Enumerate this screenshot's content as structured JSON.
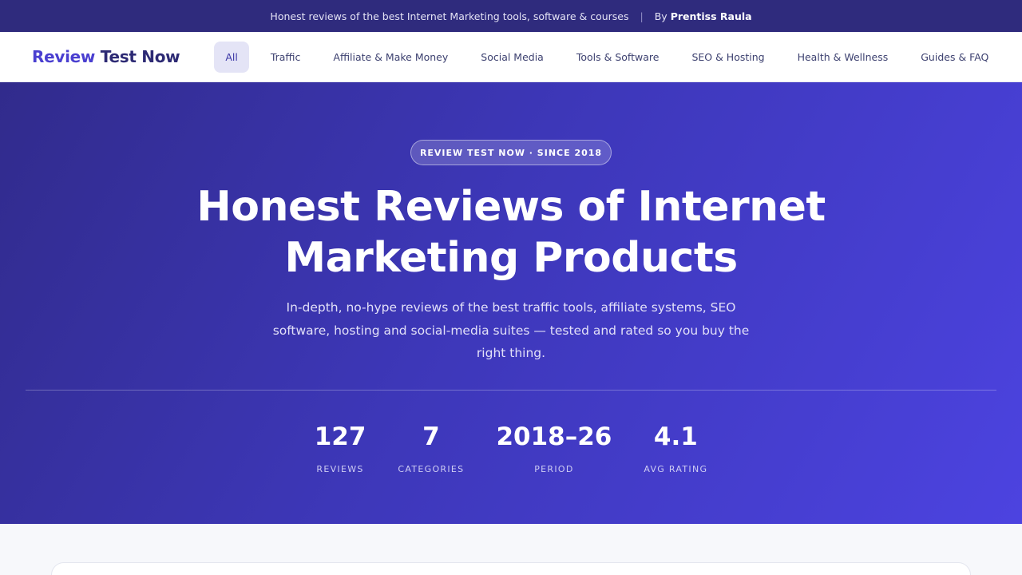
{
  "topbar": {
    "tagline": "Honest reviews of the best Internet Marketing tools, software & courses",
    "separator": "|",
    "by_label": "By",
    "author": "Prentiss Raula"
  },
  "logo": {
    "part1": "Review",
    "part2": "Test Now"
  },
  "nav": {
    "items": [
      {
        "label": "All",
        "active": true
      },
      {
        "label": "Traffic"
      },
      {
        "label": "Affiliate & Make Money"
      },
      {
        "label": "Social Media"
      },
      {
        "label": "Tools & Software"
      },
      {
        "label": "SEO & Hosting"
      },
      {
        "label": "Health & Wellness"
      },
      {
        "label": "Guides & FAQ"
      }
    ]
  },
  "hero": {
    "badge": "REVIEW TEST NOW · SINCE 2018",
    "title": "Honest Reviews of Internet Marketing Products",
    "subtitle": "In-depth, no-hype reviews of the best traffic tools, affiliate systems, SEO software, hosting and social-media suites — tested and rated so you buy the right thing.",
    "stats": [
      {
        "value": "127",
        "label": "REVIEWS"
      },
      {
        "value": "7",
        "label": "CATEGORIES"
      },
      {
        "value": "2018–26",
        "label": "PERIOD"
      },
      {
        "value": "4.1",
        "label": "AVG RATING"
      }
    ]
  },
  "colors": {
    "topbar_bg": "#2f2b7d",
    "accent": "#4a3fd0",
    "hero_gradient_start": "#312b8c",
    "hero_gradient_end": "#4c43e0"
  }
}
